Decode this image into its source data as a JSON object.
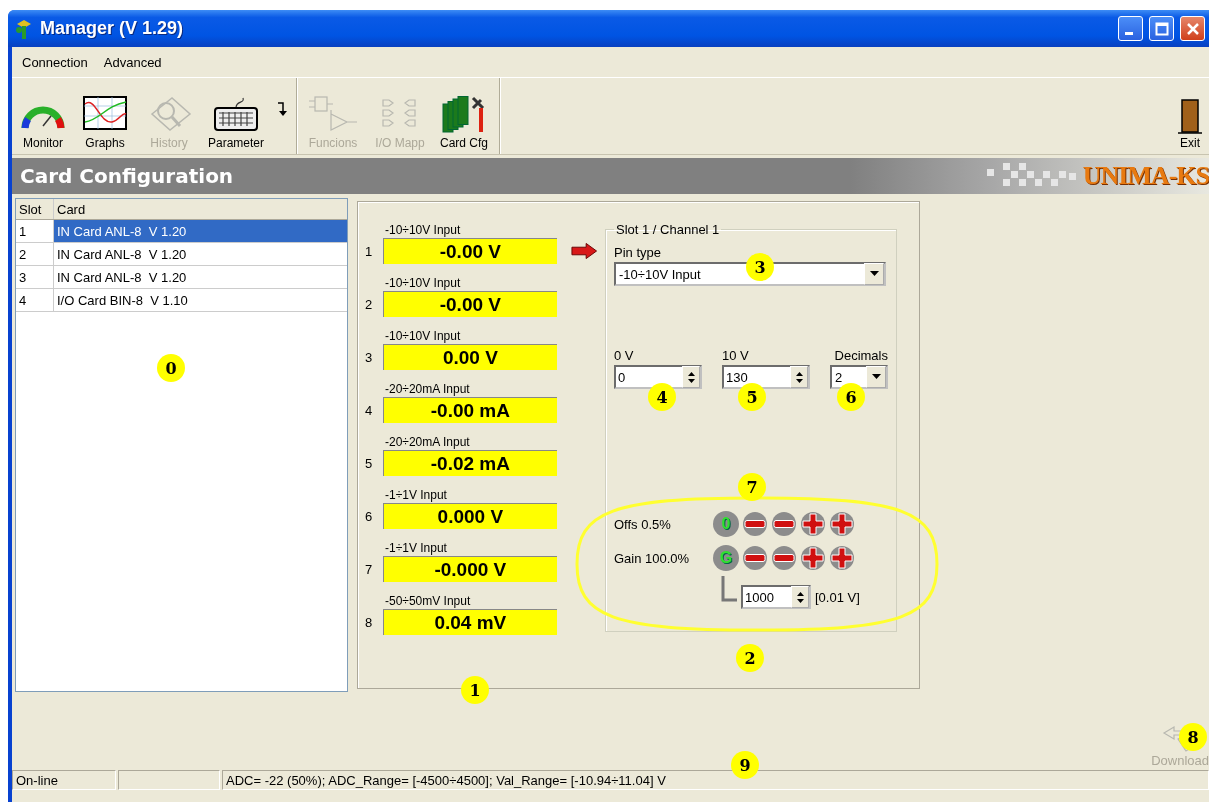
{
  "window": {
    "title": "Manager (V 1.29)"
  },
  "menu": [
    {
      "label": "Connection"
    },
    {
      "label": "Advanced"
    }
  ],
  "toolbar": {
    "groups": [
      [
        {
          "kind": "gauge",
          "label": "Monitor",
          "disabled": false
        },
        {
          "kind": "graph",
          "label": "Graphs",
          "disabled": false
        },
        {
          "kind": "history",
          "label": "History",
          "disabled": true
        },
        {
          "kind": "keyboard",
          "label": "Parameter",
          "disabled": false
        },
        {
          "kind": "dropdown",
          "disabled": false
        }
      ],
      [
        {
          "kind": "logic",
          "label": "Funcions",
          "disabled": true
        },
        {
          "kind": "io",
          "label": "I/O Mapp",
          "disabled": true
        },
        {
          "kind": "cards",
          "label": "Card Cfg",
          "disabled": false
        }
      ]
    ],
    "exit": {
      "label": "Exit"
    }
  },
  "header": {
    "title": "Card Configuration",
    "logo": "UNIMA-KS"
  },
  "slots": {
    "columns": [
      "Slot",
      "Card"
    ],
    "rows": [
      {
        "slot": "1",
        "card": "IN Card ANL-8  V 1.20",
        "selected": true
      },
      {
        "slot": "2",
        "card": "IN Card ANL-8  V 1.20",
        "selected": false
      },
      {
        "slot": "3",
        "card": "IN Card ANL-8  V 1.20",
        "selected": false
      },
      {
        "slot": "4",
        "card": "I/O Card BIN-8  V 1.10",
        "selected": false
      }
    ]
  },
  "channels": [
    {
      "number": "1",
      "type": "-10÷10V Input",
      "value": "-0.00 V",
      "selected": true
    },
    {
      "number": "2",
      "type": "-10÷10V Input",
      "value": "-0.00 V",
      "selected": false
    },
    {
      "number": "3",
      "type": "-10÷10V Input",
      "value": "0.00 V",
      "selected": false
    },
    {
      "number": "4",
      "type": "-20÷20mA Input",
      "value": "-0.00 mA",
      "selected": false
    },
    {
      "number": "5",
      "type": "-20÷20mA Input",
      "value": "-0.02 mA",
      "selected": false
    },
    {
      "number": "6",
      "type": "-1÷1V Input",
      "value": "0.000 V",
      "selected": false
    },
    {
      "number": "7",
      "type": "-1÷1V Input",
      "value": "-0.000 V",
      "selected": false
    },
    {
      "number": "8",
      "type": "-50÷50mV Input",
      "value": "0.04 mV",
      "selected": false
    }
  ],
  "channel_config": {
    "title": "Slot 1 / Channel 1",
    "pin_type": {
      "label": "Pin type",
      "value": "-10÷10V Input"
    },
    "zero": {
      "label": "0 V",
      "value": "0"
    },
    "full": {
      "label": "10 V",
      "value": "130"
    },
    "decimals": {
      "label": "Decimals",
      "value": "2"
    },
    "offset": {
      "label": "Offs 0.5%",
      "reset": "0"
    },
    "gain": {
      "label": "Gain 100.0%",
      "reset": "G",
      "value": "1000",
      "unit": "[0.01 V]"
    }
  },
  "download": {
    "label": "Download",
    "disabled": true
  },
  "status_bar": {
    "state": "On-line",
    "message": "ADC= -22 (50%); ADC_Range= [-4500÷4500]; Val_Range= [-10.94÷11.04] V"
  },
  "callouts": [
    "0",
    "1",
    "2",
    "3",
    "4",
    "5",
    "6",
    "7",
    "8",
    "9"
  ]
}
